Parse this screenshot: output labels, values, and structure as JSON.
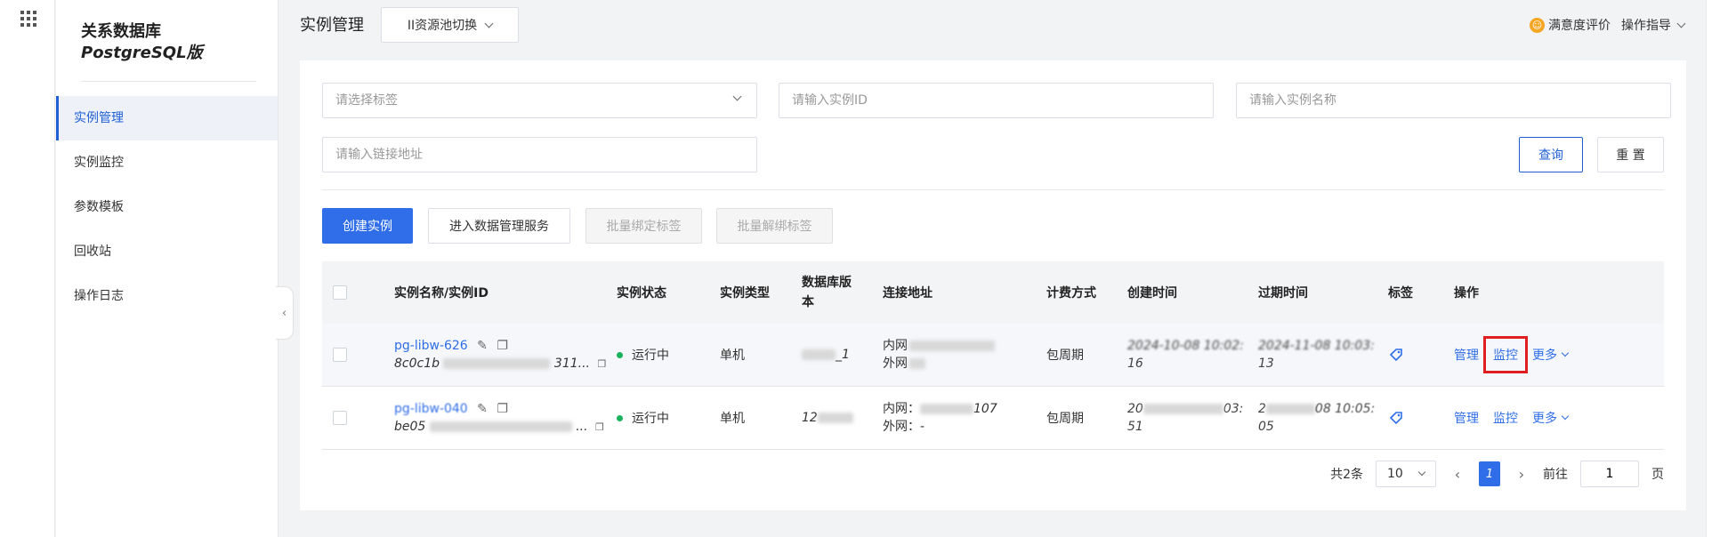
{
  "sidebar": {
    "product_title": "关系数据库",
    "product_subtitle": "PostgreSQL版",
    "items": [
      {
        "label": "实例管理",
        "active": true
      },
      {
        "label": "实例监控"
      },
      {
        "label": "参数模板"
      },
      {
        "label": "回收站"
      },
      {
        "label": "操作日志"
      }
    ]
  },
  "header": {
    "title": "实例管理",
    "pool_switch": "II资源池切换",
    "satisfaction": "满意度评价",
    "guide": "操作指导"
  },
  "filters": {
    "tag_placeholder": "请选择标签",
    "id_placeholder": "请输入实例ID",
    "name_placeholder": "请输入实例名称",
    "address_placeholder": "请输入链接地址",
    "query": "查询",
    "reset": "重 置"
  },
  "actions": {
    "create": "创建实例",
    "data_service": "进入数据管理服务",
    "bind_tags": "批量绑定标签",
    "unbind_tags": "批量解绑标签"
  },
  "table": {
    "headers": {
      "name": "实例名称/实例ID",
      "status": "实例状态",
      "type": "实例类型",
      "db_version": "数据库版本",
      "address": "连接地址",
      "billing": "计费方式",
      "created": "创建时间",
      "expires": "过期时间",
      "tags": "标签",
      "ops": "操作"
    },
    "rows": [
      {
        "name": "pg-libw-626",
        "id_prefix": "8c0c1b",
        "id_suffix": "311...",
        "status": "运行中",
        "type": "单机",
        "db_version_suffix": "_1",
        "addr_inner": "内网",
        "addr_outer": "外网",
        "billing": "包周期",
        "created_line1": "2024-10-08 10:02:",
        "created_line2": "16",
        "expires_line1": "2024-11-08 10:03:",
        "expires_line2": "13",
        "op_manage": "管理",
        "op_monitor": "监控",
        "op_more": "更多"
      },
      {
        "name": "pg-libw-040",
        "id_prefix": "be05",
        "id_suffix": "...",
        "status": "运行中",
        "type": "单机",
        "db_version_prefix": "12",
        "addr_inner": "内网：",
        "addr_inner_suffix": "107",
        "addr_outer": "外网：-",
        "billing": "包周期",
        "created_line1_prefix": "20",
        "created_line1_suffix": "03:",
        "created_line2": "51",
        "expires_line1_prefix": "2",
        "expires_line1_suffix": "08 10:05:",
        "expires_line2": "05",
        "op_manage": "管理",
        "op_monitor": "监控",
        "op_more": "更多"
      }
    ]
  },
  "pagination": {
    "total": "共2条",
    "page_size": "10",
    "current_page": "1",
    "goto_label": "前往",
    "goto_value": "1",
    "page_unit": "页"
  },
  "colors": {
    "primary": "#2f6ee8",
    "active_nav": "#1f5fd6",
    "running": "#19b35b",
    "highlight": "#e02020"
  }
}
